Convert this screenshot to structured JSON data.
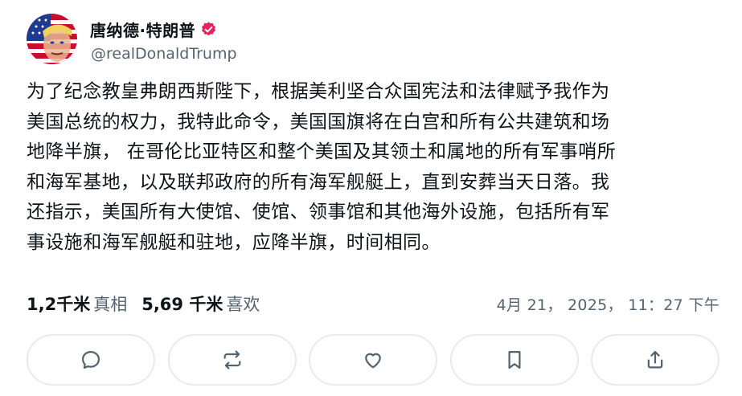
{
  "post": {
    "author": {
      "display_name": "唐纳德·特朗普",
      "handle": "@realDonaldTrump",
      "avatar_icon": "flag-portrait-avatar",
      "verified_icon": "verified-badge-icon",
      "verified_color": "#e0245e"
    },
    "body_text": "为了纪念教皇弗朗西斯陛下，根据美利坚合众国宪法和法律赋予我作为\n美国总统的权力，我特此命令，美国国旗将在白宫和所有公共建筑和场\n地降半旗， 在哥伦比亚特区和整个美国及其领土和属地的所有军事哨所\n和海军基地，以及联邦政府的所有海军舰艇上，直到安葬当天日落。我\n还指示，美国所有大使馆、使馆、领事馆和其他海外设施，包括所有军\n事设施和海军舰艇和驻地，应降半旗，时间相同。",
    "stats": {
      "reposts_count": "1,2千米",
      "reposts_label": "真相",
      "likes_count": "5,69 千米",
      "likes_label": "喜欢"
    },
    "timestamp": "4月 21， 2025， 11：27 下午",
    "actions": [
      {
        "name": "reply",
        "icon": "reply-icon"
      },
      {
        "name": "repost",
        "icon": "repost-icon"
      },
      {
        "name": "like",
        "icon": "heart-icon"
      },
      {
        "name": "bookmark",
        "icon": "bookmark-icon"
      },
      {
        "name": "share",
        "icon": "share-icon"
      }
    ]
  }
}
